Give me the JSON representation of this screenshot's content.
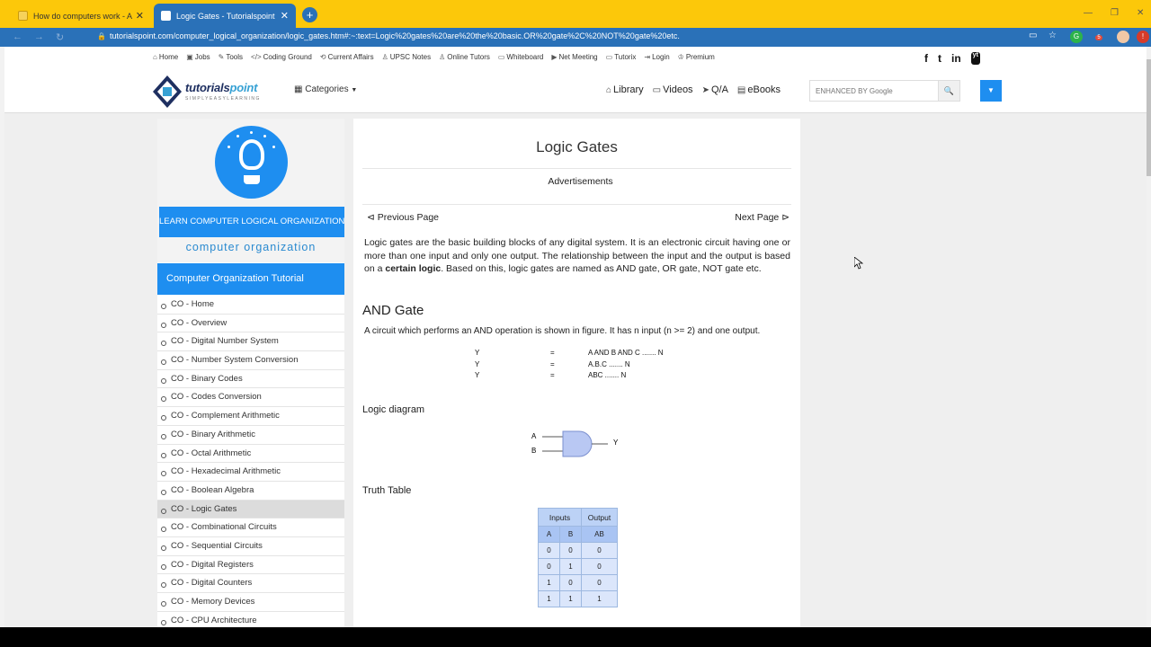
{
  "browser": {
    "tabs": [
      {
        "title": "How do computers work - Atom",
        "active": false
      },
      {
        "title": "Logic Gates - Tutorialspoint",
        "active": true
      }
    ],
    "new_tab": "+",
    "url": "tutorialspoint.com/computer_logical_organization/logic_gates.htm#:~:text=Logic%20gates%20are%20the%20basic.OR%20gate%2C%20NOT%20gate%20etc.",
    "ext_badge": "5"
  },
  "topbar": {
    "links": [
      "Home",
      "Jobs",
      "Tools",
      "Coding Ground",
      "Current Affairs",
      "UPSC Notes",
      "Online Tutors",
      "Whiteboard",
      "Net Meeting",
      "Tutorix",
      "Login",
      "Premium"
    ],
    "social": [
      "f",
      "t",
      "in",
      "yt"
    ]
  },
  "header": {
    "logo_text_a": "tutorials",
    "logo_text_b": "point",
    "logo_slogan": "SIMPLYEASYLEARNING",
    "categories": "Categories",
    "menu": [
      "Library",
      "Videos",
      "Q/A",
      "eBooks"
    ],
    "search_placeholder": "ENHANCED BY Google"
  },
  "sidebar": {
    "banner": "LEARN COMPUTER LOGICAL ORGANIZATION",
    "subtitle": "computer organization",
    "heading": "Computer Organization Tutorial",
    "items": [
      "CO - Home",
      "CO - Overview",
      "CO - Digital Number System",
      "CO - Number System Conversion",
      "CO - Binary Codes",
      "CO - Codes Conversion",
      "CO - Complement Arithmetic",
      "CO - Binary Arithmetic",
      "CO - Octal Arithmetic",
      "CO - Hexadecimal Arithmetic",
      "CO - Boolean Algebra",
      "CO - Logic Gates",
      "CO - Combinational Circuits",
      "CO - Sequential Circuits",
      "CO - Digital Registers",
      "CO - Digital Counters",
      "CO - Memory Devices",
      "CO - CPU Architecture"
    ],
    "active_index": 11
  },
  "main": {
    "title": "Logic Gates",
    "ads": "Advertisements",
    "prev": "Previous Page",
    "next": "Next Page",
    "intro_a": "Logic gates are the basic building blocks of any digital system. It is an electronic circuit having one or more than one input and only one output. The relationship between the input and the output is based on a ",
    "intro_bold": "certain logic",
    "intro_b": ". Based on this, logic gates are named as AND gate, OR gate, NOT gate etc.",
    "and_heading": "AND Gate",
    "and_desc": "A circuit which performs an AND operation is shown in figure. It has n input (n >= 2) and one output.",
    "equations": [
      {
        "lhs": "Y",
        "eq": "=",
        "rhs": "A AND B AND C ....... N"
      },
      {
        "lhs": "Y",
        "eq": "=",
        "rhs": "A.B.C ....... N"
      },
      {
        "lhs": "Y",
        "eq": "=",
        "rhs": "ABC ....... N"
      }
    ],
    "diagram_heading": "Logic diagram",
    "diagram_labels": {
      "a": "A",
      "b": "B",
      "y": "Y"
    },
    "truth_heading": "Truth Table",
    "truth_table": {
      "group_headers": [
        "Inputs",
        "Output"
      ],
      "columns": [
        "A",
        "B",
        "AB"
      ],
      "rows": [
        [
          "0",
          "0",
          "0"
        ],
        [
          "0",
          "1",
          "0"
        ],
        [
          "1",
          "0",
          "0"
        ],
        [
          "1",
          "1",
          "1"
        ]
      ]
    }
  }
}
